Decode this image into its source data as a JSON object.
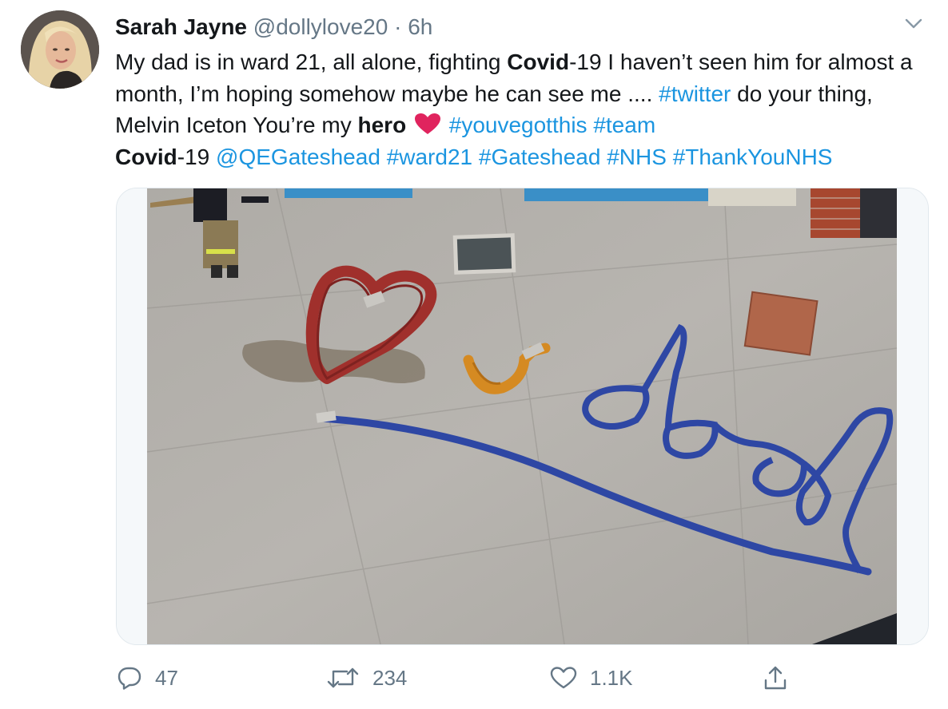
{
  "tweet": {
    "author_name": "Sarah Jayne",
    "handle": "@dollylove20",
    "separator": "·",
    "time": "6h",
    "text": {
      "t1": "My dad is in ward 21, all alone,  fighting ",
      "b1": "Covid",
      "t2": "-19 I haven’t seen him for almost a month, I’m hoping somehow maybe he can see me .... ",
      "h1": "#twitter",
      "t3": " do your thing, Melvin Iceton You’re my ",
      "b2": "hero",
      "h2": "#youvegotthis",
      "t4": " ",
      "h3": "#team",
      "t5": " ",
      "b3": "Covid",
      "t6": "-19 ",
      "m1": "@QEGateshead",
      "t7": " ",
      "h4": "#ward21",
      "t8": " ",
      "h5": "#Gateshead",
      "t9": " ",
      "h6": "#NHS",
      "t10": " ",
      "h7": "#ThankYouNHS"
    }
  },
  "actions": {
    "reply_count": "47",
    "retweet_count": "234",
    "like_count": "1.1K"
  },
  "colors": {
    "link": "#1b95e0",
    "muted": "#657786",
    "heart_emoji": "#e0245e",
    "hose_red": "#a0302c",
    "hose_yellow": "#d58a22",
    "hose_blue": "#2e47a4"
  },
  "icons": [
    "chevron-down-icon",
    "red-heart-emoji",
    "reply-icon",
    "retweet-icon",
    "like-icon",
    "share-icon"
  ]
}
